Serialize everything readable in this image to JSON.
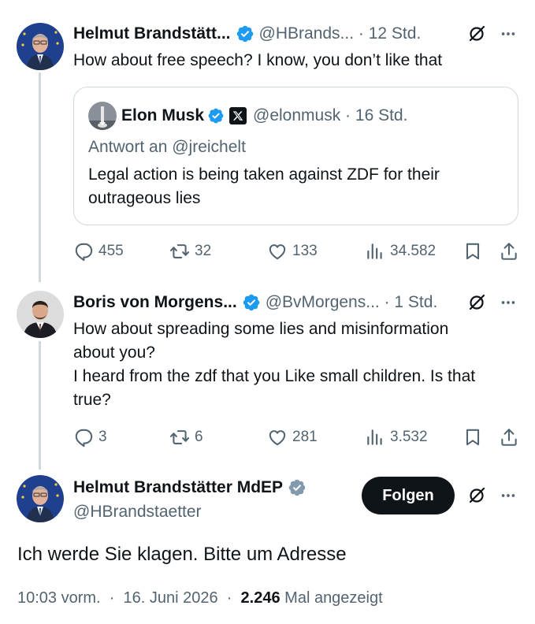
{
  "tweets": [
    {
      "name": "Helmut Brandstätt...",
      "handle": "@HBrands...",
      "time": "12 Std.",
      "text": "How about free speech? I know, you don’t like that",
      "quote": {
        "name": "Elon Musk",
        "handle": "@elonmusk",
        "time": "16 Std.",
        "reply_to": "Antwort an @jreichelt",
        "text_line1": "Legal action is being taken against ZDF for their",
        "text_line2": "outrageous lies"
      },
      "stats": {
        "replies": "455",
        "retweets": "32",
        "likes": "133",
        "views": "34.582"
      }
    },
    {
      "name": "Boris von Morgens...",
      "handle": "@BvMorgens...",
      "time": "1 Std.",
      "text_line1": "How about spreading some lies and misinformation",
      "text_line2": "about you?",
      "text_line3": "I heard from the zdf that you Like small children. Is that",
      "text_line4": "true?",
      "stats": {
        "replies": "3",
        "retweets": "6",
        "likes": "281",
        "views": "3.532"
      }
    }
  ],
  "main": {
    "name": "Helmut Brandstätter MdEP",
    "handle": "@HBrandstaetter",
    "follow_label": "Folgen",
    "text": "Ich werde Sie klagen. Bitte um Adresse",
    "time": "10:03 vorm.",
    "date": "16. Juni 2026",
    "views_count": "2.246",
    "views_label": "Mal angezeigt"
  },
  "colors": {
    "verified": "#1d9bf0",
    "text": "#0f1419",
    "secondary": "#536471",
    "border": "#cfd9de",
    "follow_bg": "#0f1419"
  },
  "icons": [
    "verified-icon",
    "grok-icon",
    "more-icon",
    "reply-icon",
    "retweet-icon",
    "like-icon",
    "views-icon",
    "bookmark-icon",
    "share-icon",
    "x-logo-icon"
  ]
}
